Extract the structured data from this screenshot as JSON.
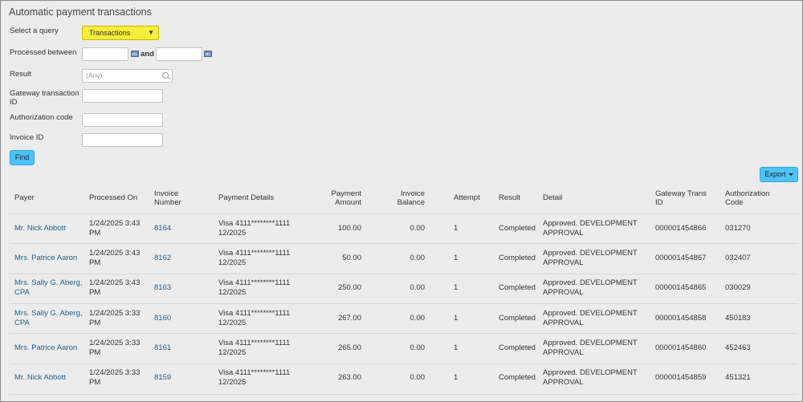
{
  "page": {
    "title": "Automatic payment transactions"
  },
  "filters": {
    "query_label": "Select a query",
    "query_value": "Transactions",
    "processed_label": "Processed between",
    "and_label": "and",
    "result_label": "Result",
    "result_placeholder": "(Any)",
    "gateway_label_line1": "Gateway transaction",
    "gateway_label_line2": "ID",
    "auth_label": "Authorization code",
    "invoice_label": "Invoice ID",
    "find_label": "Find"
  },
  "toolbar": {
    "export_label": "Export"
  },
  "table": {
    "headers": [
      [
        "Payer"
      ],
      [
        "Processed On"
      ],
      [
        "Invoice",
        "Number"
      ],
      [
        "Payment Details"
      ],
      [
        "Payment",
        "Amount"
      ],
      [
        "Invoice",
        "Balance"
      ],
      [
        "Attempt"
      ],
      [
        "Result"
      ],
      [
        "Detail"
      ],
      [
        "Gateway Trans",
        "ID"
      ],
      [
        "Authorization",
        "Code"
      ]
    ],
    "rows": [
      {
        "payer": [
          "Mr. Nick Abbott"
        ],
        "processed": [
          "1/24/2025 3:43",
          "PM"
        ],
        "invoice": "8164",
        "details": [
          "Visa 4111********1111",
          "12/2025"
        ],
        "amount": "100.00",
        "balance": "0.00",
        "attempt": "1",
        "result": "Completed",
        "detail": [
          "Approved. DEVELOPMENT",
          "APPROVAL"
        ],
        "gateway": "000001454866",
        "auth": "031270"
      },
      {
        "payer": [
          "Mrs. Patrice Aaron"
        ],
        "processed": [
          "1/24/2025 3:43",
          "PM"
        ],
        "invoice": "8162",
        "details": [
          "Visa 4111********1111",
          "12/2025"
        ],
        "amount": "50.00",
        "balance": "0.00",
        "attempt": "1",
        "result": "Completed",
        "detail": [
          "Approved. DEVELOPMENT",
          "APPROVAL"
        ],
        "gateway": "000001454867",
        "auth": "032407"
      },
      {
        "payer": [
          "Mrs. Sally G. Aberg,",
          "CPA"
        ],
        "processed": [
          "1/24/2025 3:43",
          "PM"
        ],
        "invoice": "8163",
        "details": [
          "Visa 4111********1111",
          "12/2025"
        ],
        "amount": "250.00",
        "balance": "0.00",
        "attempt": "1",
        "result": "Completed",
        "detail": [
          "Approved. DEVELOPMENT",
          "APPROVAL"
        ],
        "gateway": "000001454865",
        "auth": "030029"
      },
      {
        "payer": [
          "Mrs. Sally G. Aberg,",
          "CPA"
        ],
        "processed": [
          "1/24/2025 3:33",
          "PM"
        ],
        "invoice": "8160",
        "details": [
          "Visa 4111********1111",
          "12/2025"
        ],
        "amount": "267.00",
        "balance": "0.00",
        "attempt": "1",
        "result": "Completed",
        "detail": [
          "Approved. DEVELOPMENT",
          "APPROVAL"
        ],
        "gateway": "000001454858",
        "auth": "450183"
      },
      {
        "payer": [
          "Mrs. Patrice Aaron"
        ],
        "processed": [
          "1/24/2025 3:33",
          "PM"
        ],
        "invoice": "8161",
        "details": [
          "Visa 4111********1111",
          "12/2025"
        ],
        "amount": "265.00",
        "balance": "0.00",
        "attempt": "1",
        "result": "Completed",
        "detail": [
          "Approved. DEVELOPMENT",
          "APPROVAL"
        ],
        "gateway": "000001454860",
        "auth": "452463"
      },
      {
        "payer": [
          "Mr. Nick Abbott"
        ],
        "processed": [
          "1/24/2025 3:33",
          "PM"
        ],
        "invoice": "8159",
        "details": [
          "Visa 4111********1111",
          "12/2025"
        ],
        "amount": "263.00",
        "balance": "0.00",
        "attempt": "1",
        "result": "Completed",
        "detail": [
          "Approved. DEVELOPMENT",
          "APPROVAL"
        ],
        "gateway": "000001454859",
        "auth": "451321"
      }
    ]
  }
}
